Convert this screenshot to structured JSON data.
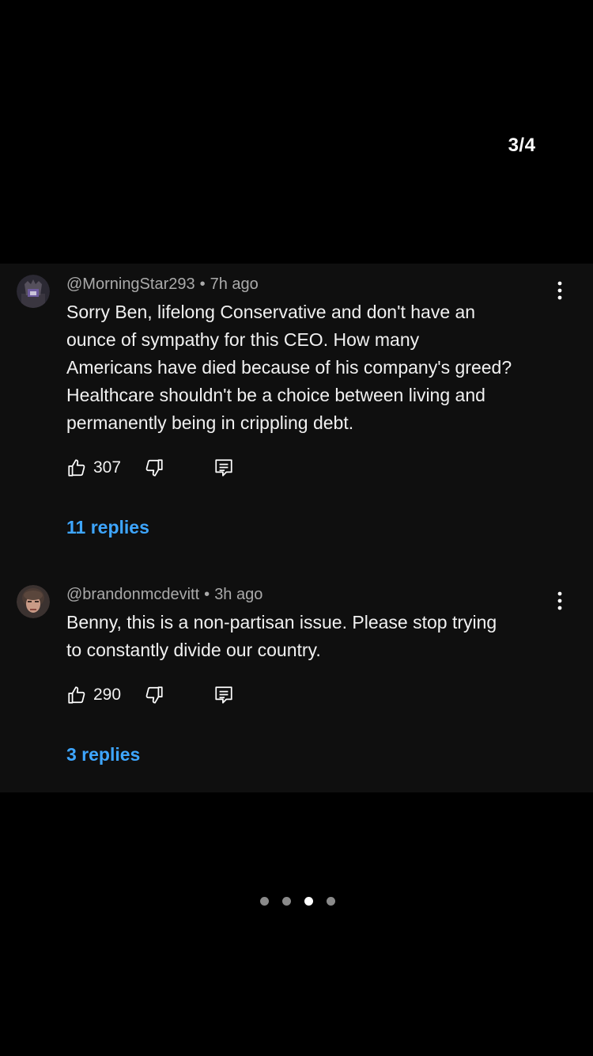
{
  "story": {
    "counter": "3/4",
    "page_dots": {
      "total": 4,
      "active_index": 2
    }
  },
  "comments": [
    {
      "username": "@MorningStar293",
      "separator": "•",
      "time": "7h ago",
      "lines": [
        "Sorry Ben, lifelong Conservative and don't have an",
        "ounce of sympathy for this CEO.  How many",
        "Americans have died because of his company's greed?",
        "Healthcare shouldn't be a choice between living and",
        "permanently being in crippling debt."
      ],
      "likes": "307",
      "replies": "11 replies",
      "avatar_icon": "throne-avatar"
    },
    {
      "username": "@brandonmcdevitt",
      "separator": "•",
      "time": "3h ago",
      "lines": [
        "Benny, this is a non-partisan issue. Please stop trying",
        "to constantly divide our country."
      ],
      "likes": "290",
      "replies": "3 replies",
      "avatar_icon": "face-avatar"
    }
  ],
  "colors": {
    "background": "#000000",
    "card": "#0f0f0f",
    "text": "#f1f1f1",
    "meta": "#aaaaaa",
    "link": "#3ea6ff"
  }
}
